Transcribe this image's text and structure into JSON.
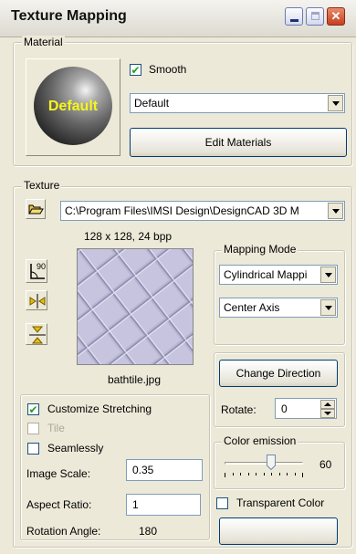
{
  "window": {
    "title": "Texture Mapping"
  },
  "material": {
    "legend": "Material",
    "preview_label": "Default",
    "smooth_label": "Smooth",
    "smooth_checked": true,
    "selected": "Default",
    "edit_button": "Edit Materials"
  },
  "texture": {
    "legend": "Texture",
    "path": "C:\\Program Files\\IMSI Design\\DesignCAD 3D M",
    "info": "128 x 128, 24 bpp",
    "filename": "bathtile.jpg",
    "rotate90_label": "90"
  },
  "mapping_mode": {
    "legend": "Mapping Mode",
    "mode": "Cylindrical Mappi",
    "axis": "Center Axis"
  },
  "direction": {
    "change_button": "Change Direction",
    "rotate_label": "Rotate:",
    "rotate_value": "0"
  },
  "stretching": {
    "customize_label": "Customize Stretching",
    "customize_checked": true,
    "tile_label": "Tile",
    "seamlessly_label": "Seamlessly",
    "image_scale_label": "Image Scale:",
    "image_scale_value": "0.35",
    "aspect_ratio_label": "Aspect Ratio:",
    "aspect_ratio_value": "1",
    "rotation_angle_label": "Rotation Angle:",
    "rotation_angle_value": "180"
  },
  "color_emission": {
    "legend": "Color emission",
    "value": "60",
    "level": 0.6
  },
  "transparent": {
    "label": "Transparent Color"
  }
}
